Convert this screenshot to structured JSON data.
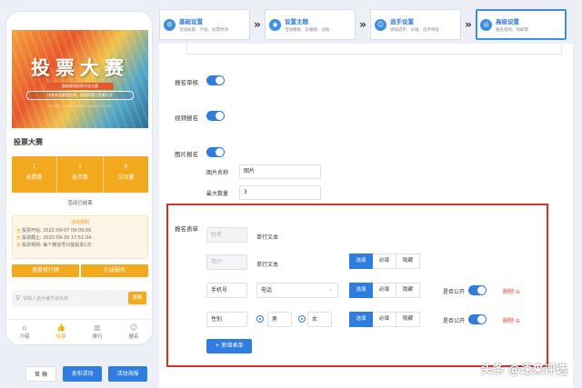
{
  "phone": {
    "banner": {
      "title": "投票大赛",
      "sub1": "超级最强投票评选大赛",
      "sub2": "快来参加最强投票，快速投票让您赢大奖",
      "sub3": "VOTE FOR YOUR FAVORITE"
    },
    "contest_title": "投票大赛",
    "stats": [
      {
        "num": "1",
        "label": "总票数"
      },
      {
        "num": "1",
        "label": "选手数"
      },
      {
        "num": "9",
        "label": "访问量"
      }
    ],
    "ended_text": "活动已结束",
    "rules": {
      "title": "活动规则",
      "items": [
        "投票开始: 2022-09-07 09:09:00",
        "投票截止: 2022-09-30 17:51:04",
        "投票规则: 每个微信号只能投票1次"
      ]
    },
    "buttons": {
      "ranking": "查看排行榜",
      "signup": "在线报名"
    },
    "search": {
      "placeholder": "请输入选手编号或名称",
      "button": "搜索"
    },
    "tabs": [
      {
        "icon": "⌂",
        "label": "介绍"
      },
      {
        "icon": "👍",
        "label": "投票"
      },
      {
        "icon": "▥",
        "label": "排行"
      },
      {
        "icon": "☺",
        "label": "报名"
      }
    ]
  },
  "bottom_buttons": {
    "draft": "草 稿",
    "publish": "发布活动",
    "poster": "活动海报"
  },
  "steps": [
    {
      "icon": "⚙",
      "name": "基础设置",
      "desc": "活动标题、介绍、投票时间"
    },
    {
      "icon": "◉",
      "name": "设置主题",
      "desc": "活动模板、轮播图、边框"
    },
    {
      "icon": "☺",
      "name": "选手设置",
      "desc": "添加选手、分组、选手审核"
    },
    {
      "icon": "◎",
      "name": "高级设置",
      "desc": "报名规则、防刷票"
    }
  ],
  "settings": {
    "signup_review": "报名审核",
    "video_signup": "视频报名",
    "image_signup": "图片报名",
    "image_name_label": "图片名称",
    "image_name_value": "图片",
    "max_count_label": "最大数量",
    "max_count_value": "3"
  },
  "form": {
    "label": "报名表单",
    "rows": [
      {
        "name_placeholder": "姓名",
        "type": "单行文本"
      },
      {
        "name_placeholder": "简介",
        "type": "单行文本",
        "options": [
          "选填",
          "必填",
          "隐藏"
        ],
        "selected": "选填"
      },
      {
        "name": "手机号",
        "type": "电话",
        "options": [
          "选填",
          "必填",
          "隐藏"
        ],
        "selected": "选填",
        "public_label": "是否公开",
        "delete": "删除 ⊖"
      },
      {
        "name": "性别",
        "choice1": "男",
        "choice2": "女",
        "options": [
          "选填",
          "必填",
          "隐藏"
        ],
        "selected": "选填",
        "public_label": "是否公开",
        "delete": "删除 ⊖"
      }
    ],
    "add_button": "+ 新增表单"
  },
  "watermark": "头条 @速来评选",
  "colors": {
    "primary": "#2f7de0",
    "accent": "#f2a91d",
    "danger": "#d9302c"
  }
}
